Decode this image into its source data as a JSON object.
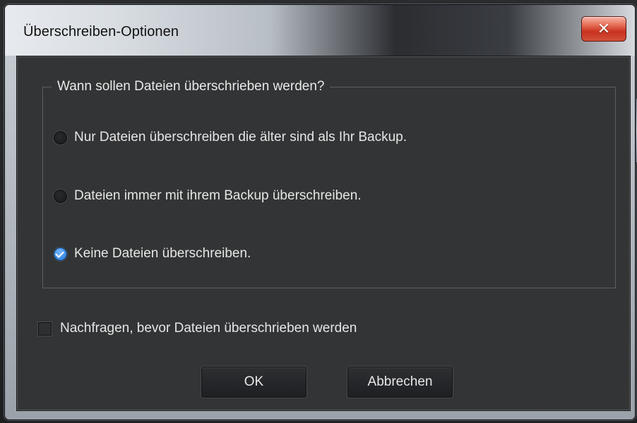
{
  "window": {
    "title": "Überschreiben-Optionen",
    "close_icon": "close-icon"
  },
  "group": {
    "legend": "Wann sollen Dateien überschrieben werden?",
    "options": [
      {
        "label": "Nur Dateien überschreiben die älter sind als Ihr Backup.",
        "selected": false
      },
      {
        "label": "Dateien immer mit ihrem Backup überschreiben.",
        "selected": false
      },
      {
        "label": "Keine Dateien überschreiben.",
        "selected": true
      }
    ]
  },
  "confirm_checkbox": {
    "label": "Nachfragen, bevor Dateien überschrieben werden",
    "checked": false
  },
  "buttons": {
    "ok_label": "OK",
    "cancel_label": "Abbrechen"
  },
  "colors": {
    "dialog_background": "#333435",
    "text": "#e6e6e6",
    "accent": "#3f8fe6",
    "close_button": "#c8321f"
  }
}
